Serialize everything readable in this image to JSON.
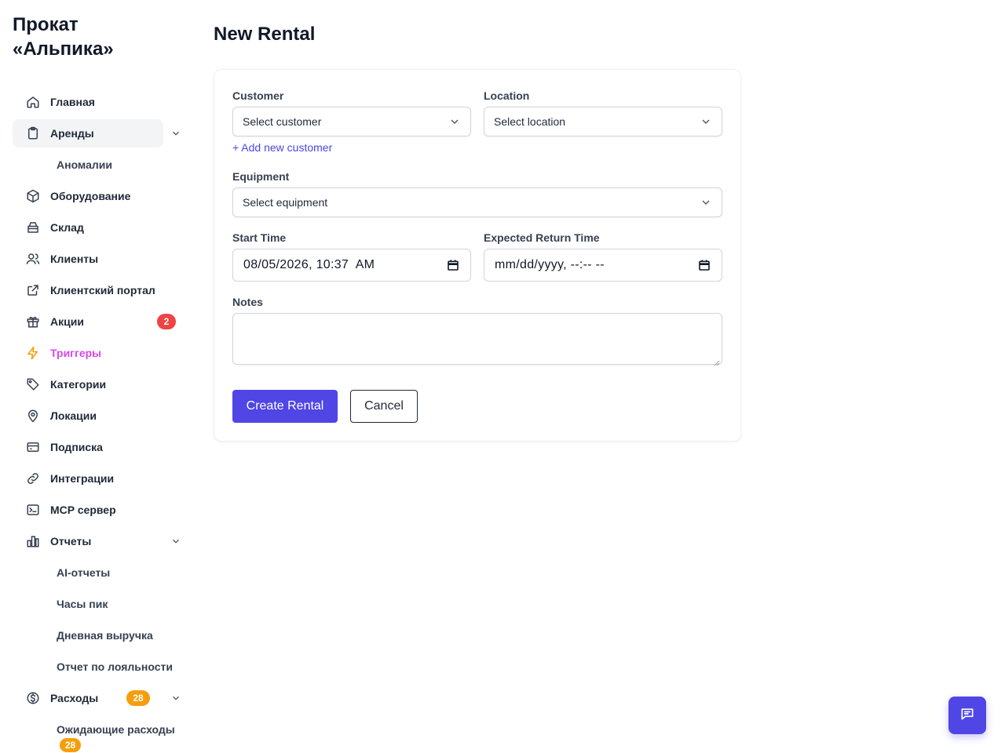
{
  "app": {
    "brand": "Прокат «Альпика»"
  },
  "sidebar": {
    "items": [
      {
        "label": "Главная",
        "icon": "home-icon"
      },
      {
        "label": "Аренды",
        "icon": "clipboard-icon"
      },
      {
        "label": "Аномалии"
      },
      {
        "label": "Оборудование",
        "icon": "cube-icon"
      },
      {
        "label": "Склад",
        "icon": "archive-icon"
      },
      {
        "label": "Клиенты",
        "icon": "users-icon"
      },
      {
        "label": "Клиентский портал",
        "icon": "external-link-icon"
      },
      {
        "label": "Акции",
        "icon": "gift-icon",
        "badge": "2"
      },
      {
        "label": "Триггеры",
        "icon": "bolt-icon"
      },
      {
        "label": "Категории",
        "icon": "tag-icon"
      },
      {
        "label": "Локации",
        "icon": "map-pin-icon"
      },
      {
        "label": "Подписка",
        "icon": "credit-card-icon"
      },
      {
        "label": "Интеграции",
        "icon": "link-icon"
      },
      {
        "label": "MCP сервер",
        "icon": "terminal-icon"
      },
      {
        "label": "Отчеты",
        "icon": "bar-chart-icon"
      },
      {
        "label": "AI-отчеты"
      },
      {
        "label": "Часы пик"
      },
      {
        "label": "Дневная выручка"
      },
      {
        "label": "Отчет по лояльности"
      },
      {
        "label": "Расходы",
        "icon": "dollar-circle-icon",
        "badge": "28"
      },
      {
        "label": "Ожидающие расходы",
        "badge": "28"
      }
    ]
  },
  "main": {
    "title": "New Rental",
    "form": {
      "customer_label": "Customer",
      "customer_value": "Select customer",
      "add_customer": "+ Add new customer",
      "location_label": "Location",
      "location_value": "Select location",
      "equipment_label": "Equipment",
      "equipment_value": "Select equipment",
      "start_label": "Start Time",
      "start_value": "08/05/2026, 10:37  AM",
      "return_label": "Expected Return Time",
      "return_value": "mm/dd/yyyy, --:-- --",
      "notes_label": "Notes",
      "notes_value": "",
      "submit": "Create Rental",
      "cancel": "Cancel"
    }
  },
  "colors": {
    "accent": "#4f46e5",
    "badge_red": "#ef4444",
    "badge_orange": "#f59e0b",
    "trigger_text": "#d946ef"
  }
}
